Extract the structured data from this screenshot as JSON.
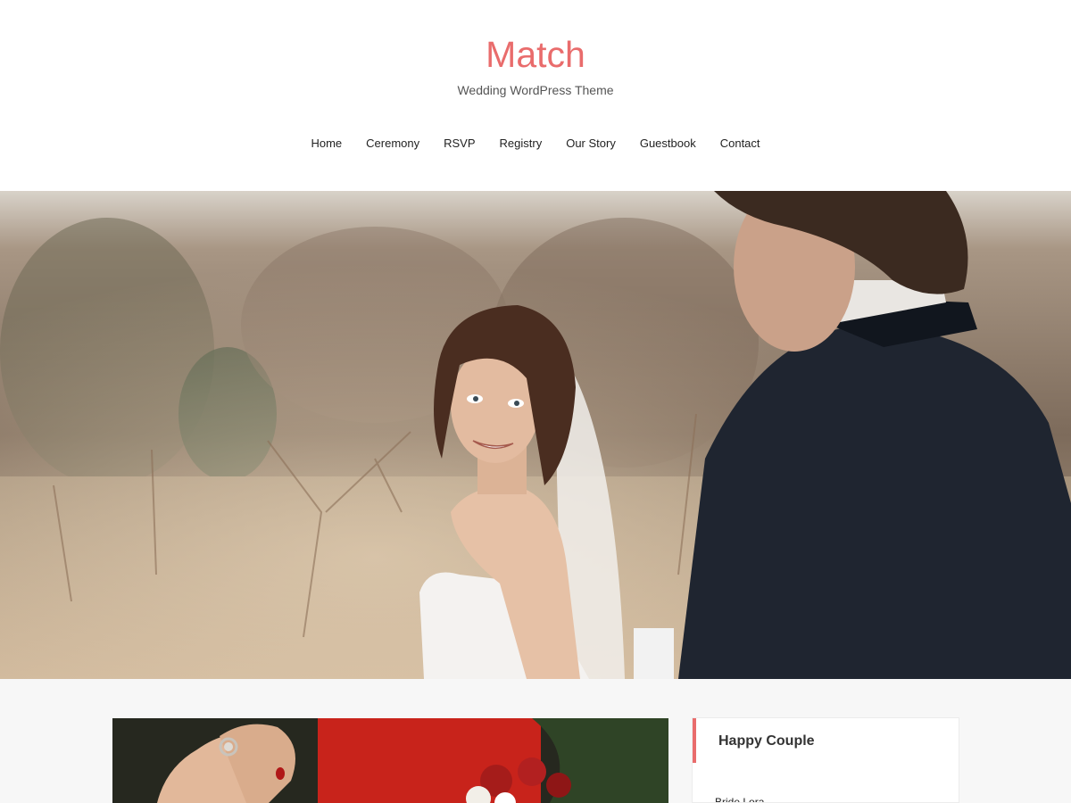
{
  "site": {
    "title": "Match",
    "tagline": "Wedding WordPress Theme"
  },
  "nav": {
    "items": [
      "Home",
      "Ceremony",
      "RSVP",
      "Registry",
      "Our Story",
      "Guestbook",
      "Contact"
    ]
  },
  "hero": {
    "image": "wedding-couple-photo"
  },
  "post": {
    "image": "couple-holding-hands-photo"
  },
  "sidebar": {
    "widget_title": "Happy Couple",
    "first_line": "Bride Lora"
  },
  "colors": {
    "accent": "#e96c6c",
    "header_bg": "#ffffff",
    "page_bg": "#f7f7f7",
    "text": "#222222"
  }
}
